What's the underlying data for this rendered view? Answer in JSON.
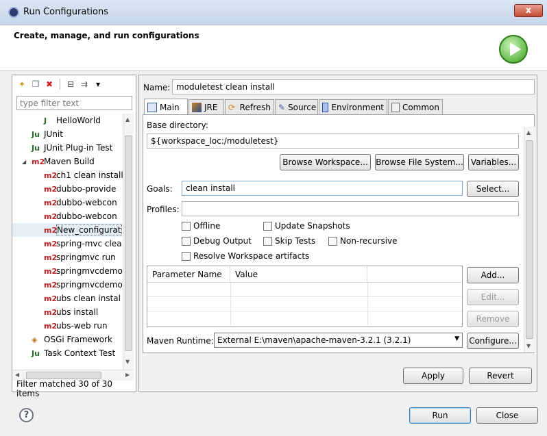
{
  "window": {
    "title": "Run Configurations",
    "close": "x"
  },
  "header": {
    "title": "Create, manage, and run configurations"
  },
  "toolbar": {
    "dropdown": "▾"
  },
  "filter": {
    "placeholder": "type filter text"
  },
  "tree": [
    {
      "label": "HelloWorld",
      "icon": "J",
      "indent": 1
    },
    {
      "label": "JUnit",
      "icon": "Ju",
      "indent": 0
    },
    {
      "label": "JUnit Plug-in Test",
      "icon": "Ju",
      "indent": 0
    },
    {
      "label": "Maven Build",
      "icon": "m2",
      "indent": 0,
      "expanded": true
    },
    {
      "label": "ch1 clean install",
      "icon": "m2",
      "indent": 1
    },
    {
      "label": "dubbo-provide",
      "icon": "m2",
      "indent": 1
    },
    {
      "label": "dubbo-webcon",
      "icon": "m2",
      "indent": 1
    },
    {
      "label": "dubbo-webcon",
      "icon": "m2",
      "indent": 1
    },
    {
      "label": "New_configurat",
      "icon": "m2",
      "indent": 1,
      "selected": true
    },
    {
      "label": "spring-mvc clea",
      "icon": "m2",
      "indent": 1
    },
    {
      "label": "springmvc run",
      "icon": "m2",
      "indent": 1
    },
    {
      "label": "springmvcdemo",
      "icon": "m2",
      "indent": 1
    },
    {
      "label": "springmvcdemo",
      "icon": "m2",
      "indent": 1
    },
    {
      "label": "ubs clean instal",
      "icon": "m2",
      "indent": 1
    },
    {
      "label": "ubs install",
      "icon": "m2",
      "indent": 1
    },
    {
      "label": "ubs-web run",
      "icon": "m2",
      "indent": 1
    },
    {
      "label": "OSGi Framework",
      "icon": "◈",
      "indent": 0
    },
    {
      "label": "Task Context Test",
      "icon": "Ju",
      "indent": 0
    }
  ],
  "filter_status": "Filter matched 30 of 30 items",
  "name": {
    "label": "Name:",
    "value": "moduletest clean install"
  },
  "tabs": [
    {
      "label": "Main",
      "active": true
    },
    {
      "label": "JRE"
    },
    {
      "label": "Refresh"
    },
    {
      "label": "Source"
    },
    {
      "label": "Environment"
    },
    {
      "label": "Common"
    }
  ],
  "main": {
    "base_dir_label": "Base directory:",
    "base_dir_value": "${workspace_loc:/moduletest}",
    "browse_workspace": "Browse Workspace...",
    "browse_fs": "Browse File System...",
    "variables": "Variables...",
    "goals_label": "Goals:",
    "goals_value": "clean install",
    "select": "Select...",
    "profiles_label": "Profiles:",
    "profiles_value": "",
    "offline": "Offline",
    "update_snapshots": "Update Snapshots",
    "debug_output": "Debug Output",
    "skip_tests": "Skip Tests",
    "non_recursive": "Non-recursive",
    "resolve_ws": "Resolve Workspace artifacts",
    "param_col": "Parameter Name",
    "value_col": "Value",
    "add": "Add...",
    "edit": "Edit...",
    "remove": "Remove",
    "runtime_label": "Maven Runtime:",
    "runtime_value": "External E:\\maven\\apache-maven-3.2.1 (3.2.1)",
    "configure": "Configure..."
  },
  "apply": "Apply",
  "revert": "Revert",
  "run": "Run",
  "close": "Close",
  "help": "?"
}
